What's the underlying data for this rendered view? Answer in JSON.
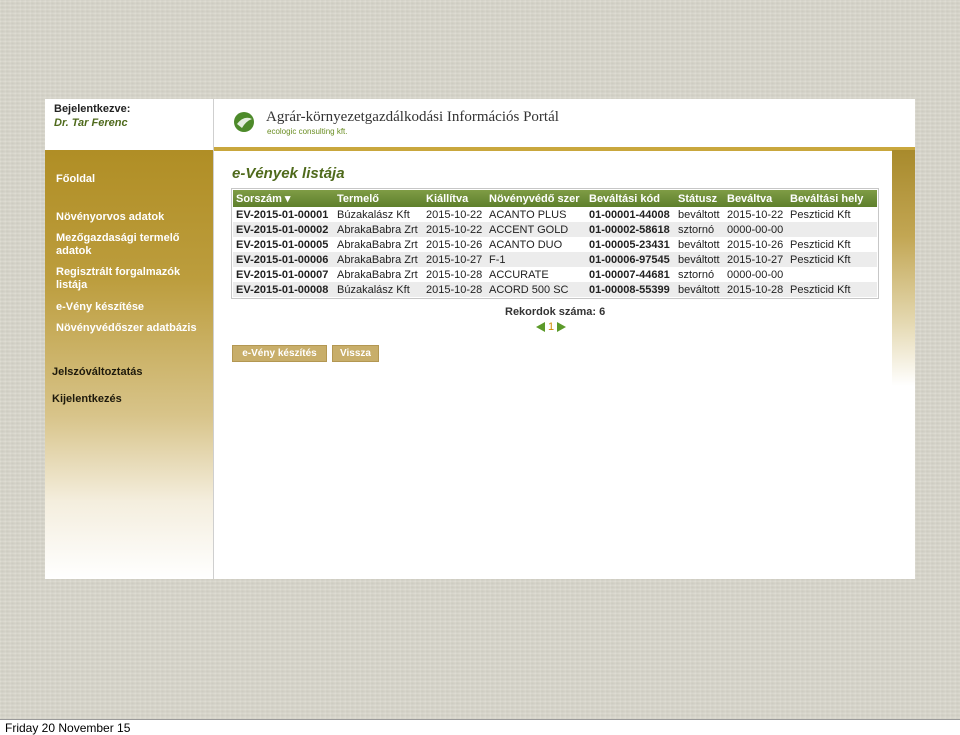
{
  "login": {
    "label": "Bejelentkezve:",
    "user": "Dr. Tar Ferenc"
  },
  "header": {
    "title": "Agrár-környezetgazdálkodási Információs Portál",
    "subtitle": "ecologic consulting kft."
  },
  "sidebar": {
    "items": [
      {
        "label": "Főoldal"
      },
      {
        "label": "Növényorvos adatok"
      },
      {
        "label": "Mezőgazdasági termelő adatok"
      },
      {
        "label": "Regisztrált forgalmazók listája"
      },
      {
        "label": "e-Vény készítése"
      },
      {
        "label": "Növényvédőszer adatbázis"
      },
      {
        "label": "Jelszóváltoztatás"
      },
      {
        "label": "Kijelentkezés"
      }
    ]
  },
  "main": {
    "title": "e-Vények listája",
    "columns": [
      "Sorszám ▾",
      "Termelő",
      "Kiállítva",
      "Növényvédő szer",
      "Beváltási kód",
      "Státusz",
      "Beváltva",
      "Beváltási hely"
    ],
    "rows": [
      [
        "EV-2015-01-00001",
        "Búzakalász Kft",
        "2015-10-22",
        "ACANTO PLUS",
        "01-00001-44008",
        "beváltott",
        "2015-10-22",
        "Peszticid Kft"
      ],
      [
        "EV-2015-01-00002",
        "AbrakaBabra Zrt",
        "2015-10-22",
        "ACCENT GOLD",
        "01-00002-58618",
        "sztornó",
        "0000-00-00",
        ""
      ],
      [
        "EV-2015-01-00005",
        "AbrakaBabra Zrt",
        "2015-10-26",
        "ACANTO DUO",
        "01-00005-23431",
        "beváltott",
        "2015-10-26",
        "Peszticid Kft"
      ],
      [
        "EV-2015-01-00006",
        "AbrakaBabra Zrt",
        "2015-10-27",
        "F-1",
        "01-00006-97545",
        "beváltott",
        "2015-10-27",
        "Peszticid Kft"
      ],
      [
        "EV-2015-01-00007",
        "AbrakaBabra Zrt",
        "2015-10-28",
        "ACCURATE",
        "01-00007-44681",
        "sztornó",
        "0000-00-00",
        ""
      ],
      [
        "EV-2015-01-00008",
        "Búzakalász Kft",
        "2015-10-28",
        "ACORD 500 SC",
        "01-00008-55399",
        "beváltott",
        "2015-10-28",
        "Peszticid Kft"
      ]
    ],
    "records": "Rekordok száma: 6",
    "page": "1",
    "buttons": {
      "create": "e-Vény készítés",
      "back": "Vissza"
    }
  },
  "os": {
    "date": "Friday 20 November 15"
  },
  "colors": {
    "accent_green": "#5e7f2c",
    "sidebar_gold": "#b08e25"
  }
}
